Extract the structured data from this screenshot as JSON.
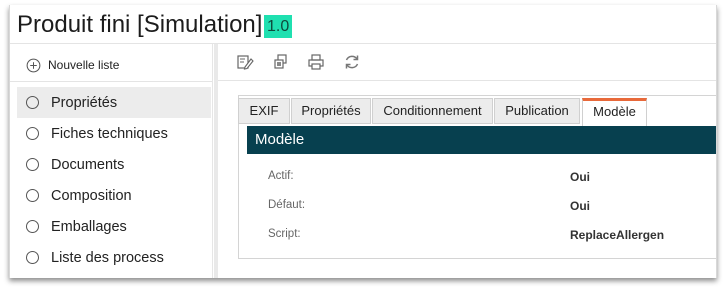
{
  "header": {
    "title": "Produit fini [Simulation]",
    "version": "1.0"
  },
  "sidebar": {
    "new_list_label": "Nouvelle liste",
    "items": [
      {
        "label": "Propriétés",
        "active": true
      },
      {
        "label": "Fiches techniques",
        "active": false
      },
      {
        "label": "Documents",
        "active": false
      },
      {
        "label": "Composition",
        "active": false
      },
      {
        "label": "Emballages",
        "active": false
      },
      {
        "label": "Liste des process",
        "active": false
      }
    ]
  },
  "toolbar": {
    "icons": [
      "edit-icon",
      "copy-icon",
      "print-icon",
      "refresh-icon"
    ]
  },
  "tabs": [
    {
      "label": "EXIF",
      "active": false
    },
    {
      "label": "Propriétés",
      "active": false
    },
    {
      "label": "Conditionnement",
      "active": false
    },
    {
      "label": "Publication",
      "active": false
    },
    {
      "label": "Modèle",
      "active": true
    }
  ],
  "section": {
    "title": "Modèle",
    "fields": [
      {
        "label": "Actif:",
        "value": "Oui"
      },
      {
        "label": "Défaut:",
        "value": "Oui"
      },
      {
        "label": "Script:",
        "value": "ReplaceAllergen"
      }
    ]
  },
  "colors": {
    "version_badge_bg": "#1fe0b0",
    "section_header_bg": "#07404f",
    "active_tab_accent": "#e8693a"
  }
}
